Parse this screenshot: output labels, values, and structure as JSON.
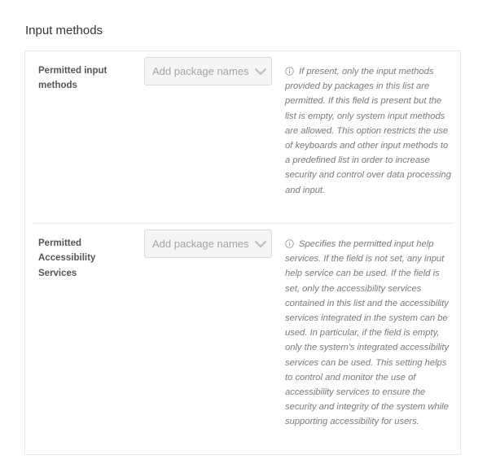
{
  "section": {
    "title": "Input methods"
  },
  "fields": [
    {
      "label": "Permitted input methods",
      "placeholder": "Add package names",
      "help_icon": "info-circle-icon",
      "help_text": "If present, only the input methods provided by packages in this list are permitted. If this field is present but the list is empty, only system input methods are allowed. This option restricts the use of keyboards and other input methods to a predefined list in order to increase security and control over data processing and input."
    },
    {
      "label": "Permitted Accessibility Services",
      "placeholder": "Add package names",
      "help_icon": "info-circle-icon",
      "help_text": "Specifies the permitted input help services. If the field is not set, any input help service can be used. If the field is set, only the accessibility services contained in this list and the accessibility services integrated in the system can be used. In particular, if the field is empty, only the system's integrated accessibility services can be used. This setting helps to control and monitor the use of accessibility services to ensure the security and integrity of the system while supporting accessibility for users."
    }
  ],
  "colors": {
    "select_background": "#f5f5f5",
    "border": "#e8e8e8",
    "help_text": "#7a7a7a"
  }
}
